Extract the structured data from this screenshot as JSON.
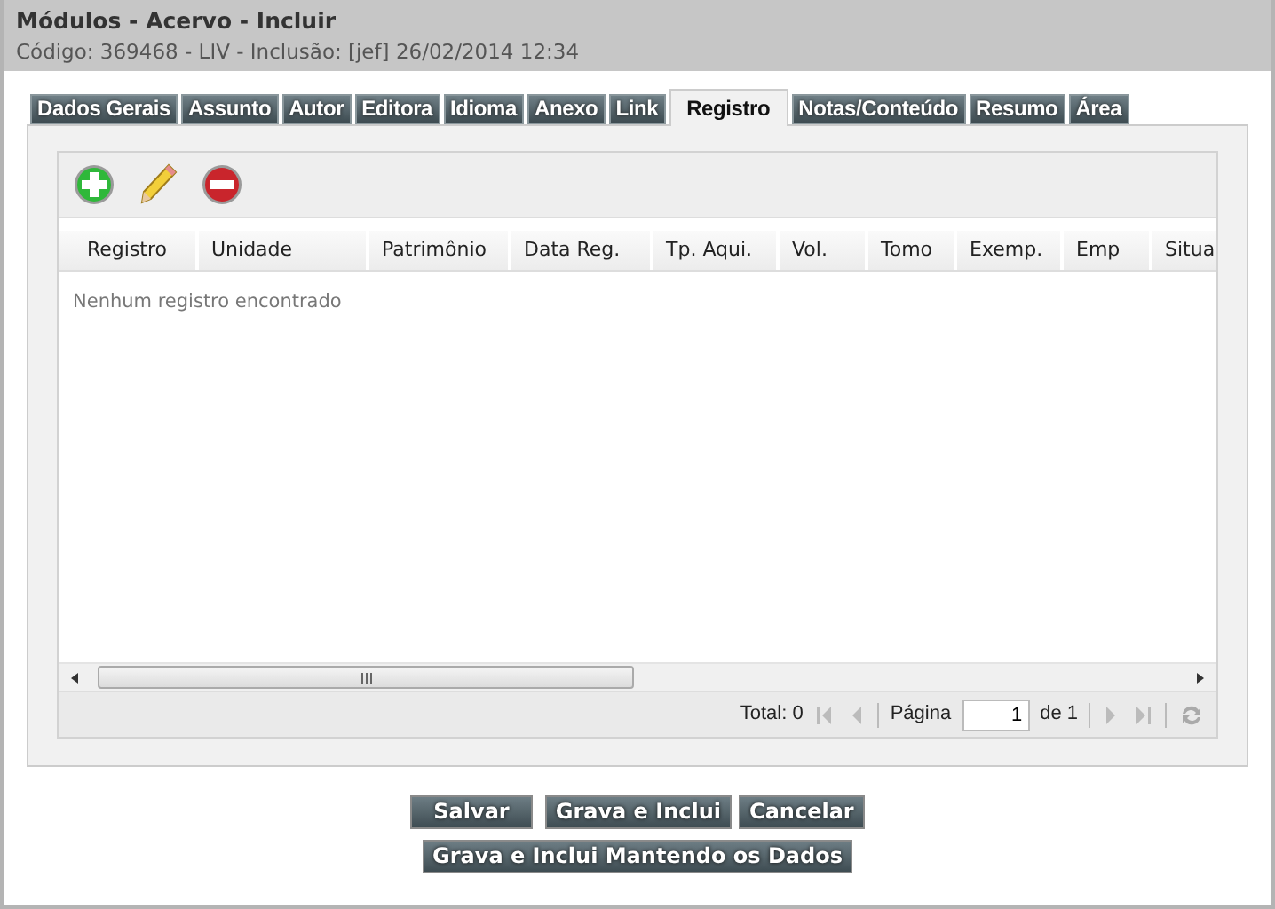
{
  "header": {
    "title": "Módulos - Acervo - Incluir",
    "subtitle": "Código: 369468 - LIV - Inclusão: [jef] 26/02/2014 12:34"
  },
  "tabs": [
    {
      "label": "Dados Gerais",
      "selected": false
    },
    {
      "label": "Assunto",
      "selected": false
    },
    {
      "label": "Autor",
      "selected": false
    },
    {
      "label": "Editora",
      "selected": false
    },
    {
      "label": "Idioma",
      "selected": false
    },
    {
      "label": "Anexo",
      "selected": false
    },
    {
      "label": "Link",
      "selected": false
    },
    {
      "label": "Registro",
      "selected": true
    },
    {
      "label": "Notas/Conteúdo",
      "selected": false
    },
    {
      "label": "Resumo",
      "selected": false
    },
    {
      "label": "Área",
      "selected": false
    }
  ],
  "table": {
    "columns": [
      "Registro",
      "Unidade",
      "Patrimônio",
      "Data Reg.",
      "Tp. Aqui.",
      "Vol.",
      "Tomo",
      "Exemp.",
      "Emp",
      "Situa"
    ],
    "empty_message": "Nenhum registro encontrado"
  },
  "pager": {
    "total": "Total: 0",
    "page_label": "Página",
    "page_value": "1",
    "page_count": "de 1"
  },
  "button_rows": [
    [
      "Salvar",
      "Grava e Inclui",
      "Cancelar"
    ],
    [
      "Grava e Inclui Mantendo os Dados"
    ]
  ]
}
